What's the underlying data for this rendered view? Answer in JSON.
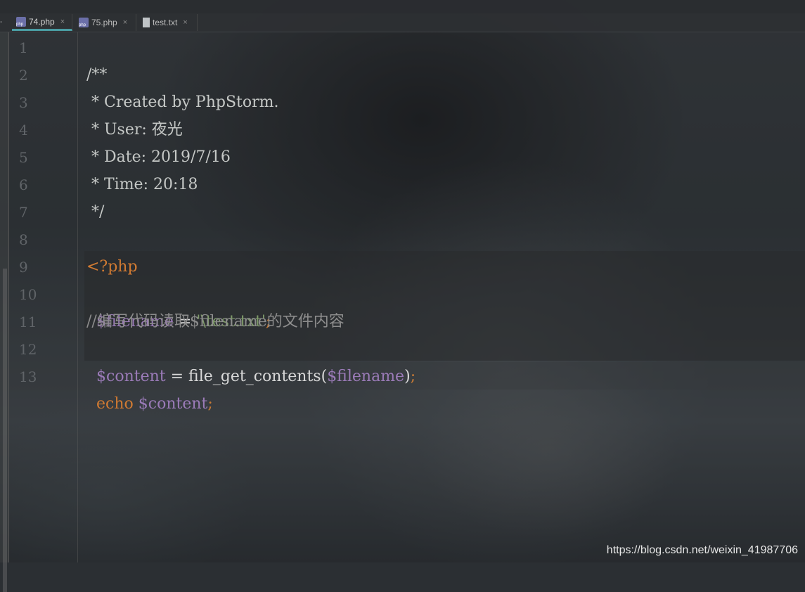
{
  "tabs": [
    {
      "label": "74.php",
      "icon": "php-file-icon",
      "active": true
    },
    {
      "label": "75.php",
      "icon": "php-file-icon",
      "active": false
    },
    {
      "label": "test.txt",
      "icon": "text-file-icon",
      "active": false
    }
  ],
  "tab_close_glyph": "×",
  "left_dash": "-",
  "line_numbers": [
    "1",
    "2",
    "3",
    "4",
    "5",
    "6",
    "7",
    "8",
    "9",
    "10",
    "11",
    "12",
    "13"
  ],
  "code": {
    "l2": "/**",
    "l3": " * Created by PhpStorm.",
    "l4": " * User: 夜光",
    "l5": " * Date: 2019/7/16",
    "l6": " * Time: 20:18",
    "l7": " */",
    "l9": "<?php",
    "l10_var": "$filename",
    "l10_eq": " = ",
    "l10_str": "'\\test.txt'",
    "l10_semi": ";",
    "l11": "//编写代码读取$filename的文件内容",
    "l12_var": "$content",
    "l12_eq": " = ",
    "l12_fn": "file_get_contents(",
    "l12_arg": "$filename",
    "l12_close": ")",
    "l12_semi": ";",
    "l13_kw": "echo",
    "l13_sp": " ",
    "l13_var": "$content",
    "l13_semi": ";"
  },
  "watermark": "https://blog.csdn.net/weixin_41987706",
  "colors": {
    "keyword": "#d07a32",
    "variable": "#9b7bb8",
    "string": "#7f9a6a",
    "tab_active_underline": "#4a9da3"
  }
}
